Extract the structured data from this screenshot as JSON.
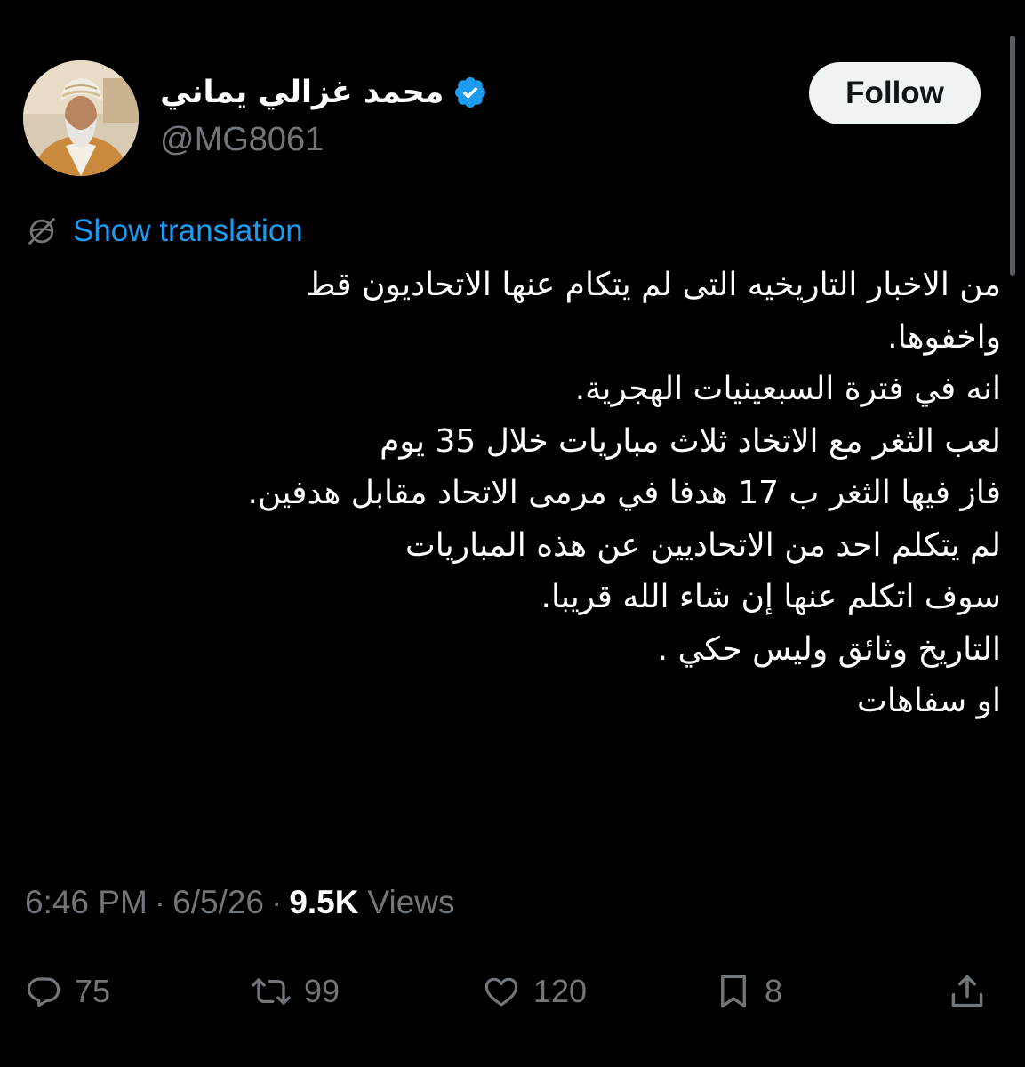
{
  "author": {
    "display_name": "محمد غزالي يماني",
    "handle": "@MG8061",
    "verified_color": "#1d9bf0"
  },
  "follow_button": {
    "label": "Follow"
  },
  "translation": {
    "label": "Show translation",
    "icon": "globe-translate-icon"
  },
  "tweet": {
    "lines": [
      "من الاخبار التاريخيه التى لم يتكام عنها الاتحاديون قط",
      "واخفوها.",
      "انه في فترة السبعينيات الهجرية.",
      "لعب الثغر مع الاتخاد ثلاث مباريات خلال 35 يوم",
      "فاز فيها الثغر ب 17 هدفا في مرمى الاتحاد مقابل هدفين.",
      "لم يتكلم احد من الاتحاديين عن هذه المباريات",
      "سوف اتكلم عنها إن شاء الله قريبا.",
      "التاريخ وثائق وليس حكي .",
      "او سفاهات"
    ]
  },
  "meta": {
    "time": "6:46 PM",
    "separator": "·",
    "date": "6/5/26",
    "views_count": "9.5K",
    "views_label": "Views"
  },
  "actions": {
    "replies": "75",
    "reposts": "99",
    "likes": "120",
    "bookmarks": "8"
  },
  "colors": {
    "background": "#000000",
    "text": "#ffffff",
    "secondary": "#71767b",
    "link": "#1d9bf0",
    "button_bg": "#eff3f4"
  }
}
